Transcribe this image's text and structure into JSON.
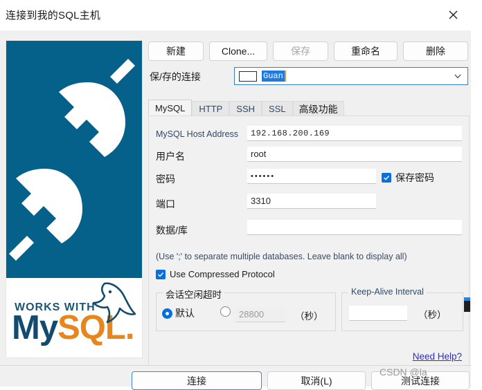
{
  "window": {
    "title": "连接到我的SQL主机",
    "close_icon": "close-icon"
  },
  "banner": {
    "graphic": "plug-connector-icon",
    "panel_color": "#05618a",
    "logo_top_text": "WORKS WITH",
    "logo_my": "My",
    "logo_sql": "SQL",
    "logo_dot": ".",
    "logo_dolphin_icon": "mysql-dolphin-icon"
  },
  "toolbar": {
    "new_label": "新建",
    "clone_label": "Clone...",
    "save_label": "保存",
    "rename_label": "重命名",
    "delete_label": "删除"
  },
  "saved_connection": {
    "label": "保/存的连接",
    "value": "Guan",
    "icon": "connection-swatch-icon",
    "arrow_icon": "chevron-down-icon"
  },
  "tabs": [
    {
      "label": "MySQL",
      "active": true
    },
    {
      "label": "HTTP",
      "active": false
    },
    {
      "label": "SSH",
      "active": false
    },
    {
      "label": "SSL",
      "active": false
    },
    {
      "label": "高级功能",
      "active": false
    }
  ],
  "form": {
    "host_label": "MySQL Host Address",
    "host_value": "192.168.200.169",
    "user_label": "用户名",
    "user_value": "root",
    "password_label": "密码",
    "password_value": "••••••",
    "save_password_label": "保存密码",
    "save_password_checked": true,
    "port_label": "端口",
    "port_value": "3310",
    "database_label": "数据/库",
    "database_value": "",
    "database_hint": "(Use ';' to separate multiple databases. Leave blank to display all)",
    "compressed_label": "Use Compressed Protocol",
    "compressed_checked": true
  },
  "idle_timeout": {
    "title": "会话空闲超时",
    "default_label": "默认",
    "default_selected": true,
    "custom_value": "28800",
    "custom_selected": false,
    "unit": "（秒）"
  },
  "keep_alive": {
    "title": "Keep-Alive Interval",
    "value": "",
    "unit": "（秒）"
  },
  "help": {
    "link_label": "Need Help?",
    "link_color": "#2b2bd8"
  },
  "footer": {
    "connect_label": "连接",
    "cancel_label": "取消(L)",
    "test_label": "测试连接",
    "watermark": "CSDN @la"
  }
}
